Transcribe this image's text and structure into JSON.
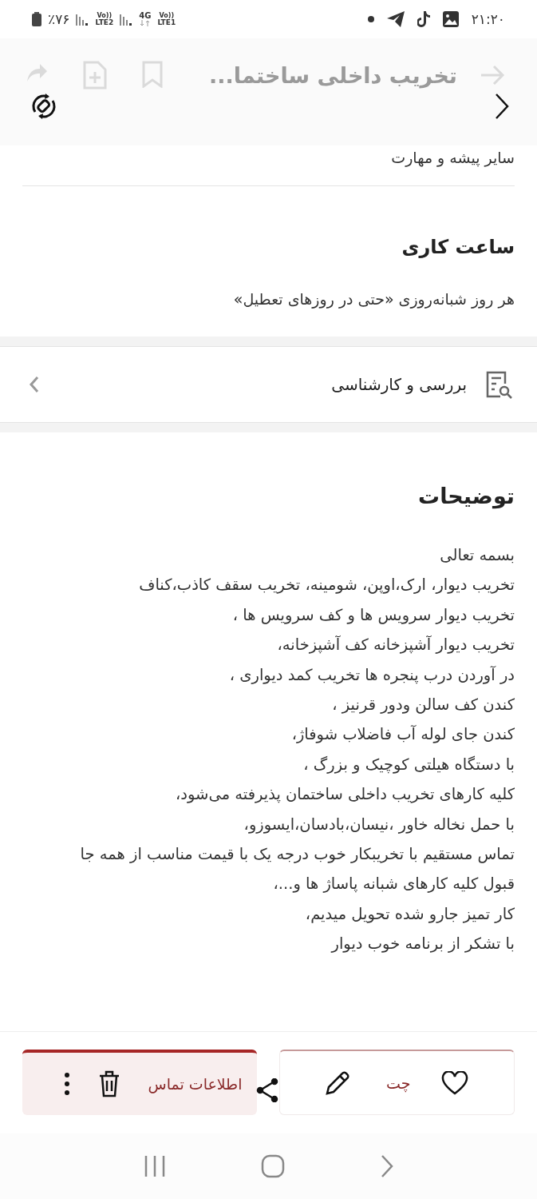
{
  "status_bar": {
    "battery": "٪۷۶",
    "volte_2": "Vo))",
    "sim_2": "LTE2",
    "network": "4G",
    "volte_1": "Vo))",
    "sim_1": "LTE1",
    "time": "۲۱:۲۰"
  },
  "header": {
    "title": "تخریب داخلی ساختما..."
  },
  "category": "سایر پیشه و مهارت",
  "working_hours": {
    "title": "ساعت کاری",
    "value": "هر روز شبانه‌روزی «حتی در روزهای تعطیل»"
  },
  "link_row": {
    "label": "بررسی و کارشناسی"
  },
  "description": {
    "title": "توضیحات",
    "lines": [
      "بسمه تعالی",
      "تخریب دیوار، ارک،اوپن، شومینه، تخریب سقف کاذب،کناف",
      "تخریب دیوار سرویس ها و کف سرویس ها ،",
      "تخریب دیوار آشپزخانه کف آشپزخانه،",
      "در آوردن درب پنجره ها تخریب کمد دیواری ،",
      "کندن کف سالن ودور قرنیز ،",
      "کندن جای لوله آب فاضلاب شوفاژ،",
      "با دستگاه هیلتی کوچیک و بزرگ ،",
      "کلیه کارهای تخریب داخلی ساختمان پذیرفته می‌شود،",
      "با حمل نخاله خاور ،نیسان،بادسان،ایسوزو،",
      "تماس مستقیم با تخریبکار خوب درجه یک با قیمت مناسب از همه جا",
      "قبول کلیه کارهای شبانه پاساژ ها و...،",
      "کار تمیز جارو شده تحویل میدیم،",
      "با تشکر از برنامه خوب دیوار"
    ]
  },
  "actions": {
    "buttons": [
      {
        "label": "چت",
        "kind": "secondary"
      },
      {
        "label": "اطلاعات تماس",
        "kind": "primary"
      }
    ]
  }
}
